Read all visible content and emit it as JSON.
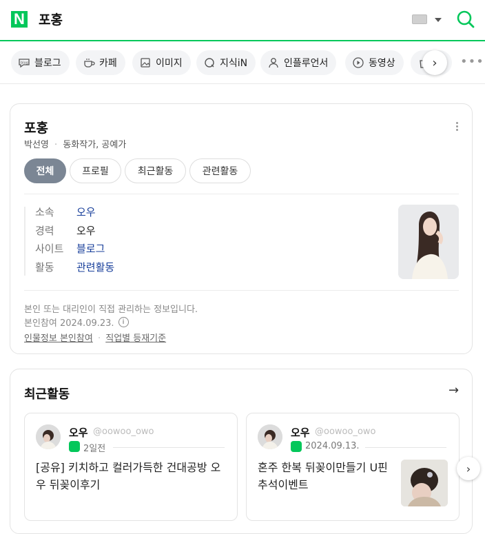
{
  "header": {
    "logo": "N",
    "query": "포홍",
    "accent": "#03c75a"
  },
  "tabs": [
    {
      "label": "블로그",
      "icon": "blog-icon"
    },
    {
      "label": "카페",
      "icon": "cafe-icon"
    },
    {
      "label": "이미지",
      "icon": "image-icon"
    },
    {
      "label": "지식iN",
      "icon": "kin-icon"
    },
    {
      "label": "인플루언서",
      "icon": "person-icon"
    },
    {
      "label": "동영상",
      "icon": "play-icon"
    },
    {
      "label": "",
      "icon": "shopping-icon"
    }
  ],
  "profile": {
    "name": "포홍",
    "real_name": "박선영",
    "separator": "·",
    "jobs": "동화작가, 공예가",
    "filters": [
      "전체",
      "프로필",
      "최근활동",
      "관련활동"
    ],
    "active_filter": "전체",
    "rows": [
      {
        "key": "소속",
        "value": "오우",
        "link": true
      },
      {
        "key": "경력",
        "value": "오우",
        "link": false
      },
      {
        "key": "사이트",
        "value": "블로그",
        "link": true
      },
      {
        "key": "활동",
        "value": "관련활동",
        "link": true
      }
    ],
    "note": "본인 또는 대리인이 직접 관리하는 정보입니다.",
    "participation": "본인참여 2024.09.23.",
    "info_icon": "info-icon",
    "links": [
      "인물정보 본인참여",
      "직업별 등재기준"
    ],
    "link_separator": "·"
  },
  "recent": {
    "title": "최근활동",
    "posts": [
      {
        "author": "오우",
        "handle": "@oowoo_owo",
        "date": "2일전",
        "text": "[공유] 키치하고 컬러가득한 건대공방 오우 뒤꽂이후기"
      },
      {
        "author": "오우",
        "handle": "@oowoo_owo",
        "date": "2024.09.13.",
        "text": "혼주 한복 뒤꽂이만들기 U핀 추석이벤트"
      }
    ]
  }
}
